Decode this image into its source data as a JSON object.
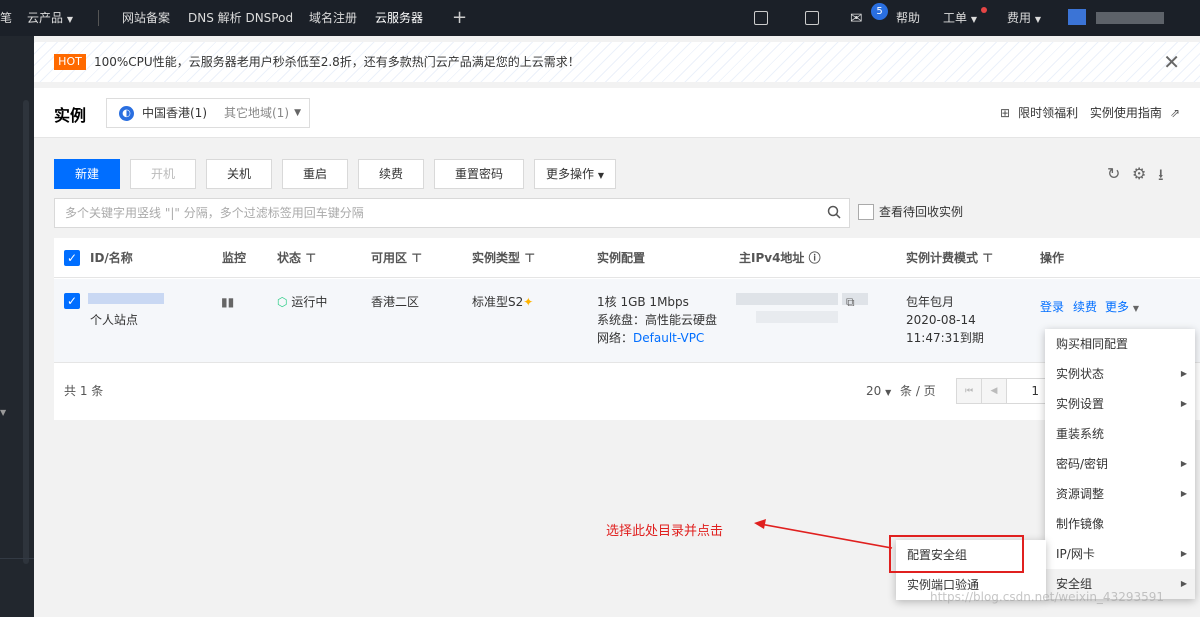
{
  "topnav": {
    "items": [
      "云产品",
      "网站备案",
      "DNS 解析 DNSPod",
      "域名注册",
      "云服务器"
    ],
    "help": "帮助",
    "ticket": "工单",
    "billing": "费用",
    "mail_badge": "5"
  },
  "notice": {
    "tag": "HOT",
    "text": "100%CPU性能，云服务器老用户秒杀低至2.8折，还有多款热门云产品满足您的上云需求！"
  },
  "header": {
    "title": "实例",
    "region_selected": "中国香港(1)",
    "region_other": "其它地域(1)",
    "link_welfare": "限时领福利",
    "link_guide": "实例使用指南"
  },
  "toolbar": {
    "new": "新建",
    "start": "开机",
    "shutdown": "关机",
    "restart": "重启",
    "renew": "续费",
    "reset_pwd": "重置密码",
    "more": "更多操作"
  },
  "search": {
    "placeholder": "多个关键字用竖线 \"|\" 分隔，多个过滤标签用回车键分隔",
    "recycle_label": "查看待回收实例"
  },
  "table": {
    "columns": [
      "ID/名称",
      "监控",
      "状态",
      "可用区",
      "实例类型",
      "实例配置",
      "主IPv4地址",
      "实例计费模式",
      "操作"
    ],
    "row": {
      "name": "个人站点",
      "status": "运行中",
      "zone": "香港二区",
      "type": "标准型S2",
      "config_line1": "1核 1GB 1Mbps",
      "config_line2": "系统盘：高性能云硬盘",
      "config_net_label": "网络：",
      "config_net_value": "Default-VPC",
      "billing_mode": "包年包月",
      "billing_date": "2020-08-14",
      "billing_time": "11:47:31到期",
      "action_login": "登录",
      "action_renew": "续费",
      "action_more": "更多"
    },
    "footer": {
      "total": "共 1 条",
      "page_size": "20",
      "per_page": "条 / 页",
      "page": "1"
    }
  },
  "menu": {
    "items": [
      {
        "label": "购买相同配置",
        "arrow": false
      },
      {
        "label": "实例状态",
        "arrow": true
      },
      {
        "label": "实例设置",
        "arrow": true
      },
      {
        "label": "重装系统",
        "arrow": false
      },
      {
        "label": "密码/密钥",
        "arrow": true
      },
      {
        "label": "资源调整",
        "arrow": true
      },
      {
        "label": "制作镜像",
        "arrow": false
      },
      {
        "label": "IP/网卡",
        "arrow": true
      },
      {
        "label": "安全组",
        "arrow": true
      }
    ],
    "submenu": [
      "配置安全组",
      "实例端口验通"
    ]
  },
  "annotation": {
    "note": "选择此处目录并点击"
  },
  "watermark": "https://blog.csdn.net/weixin_43293591",
  "colors": {
    "primary": "#006eff",
    "hot": "#ff6a00",
    "annotation_red": "#e0201f",
    "nav_bg": "#1b2028"
  }
}
